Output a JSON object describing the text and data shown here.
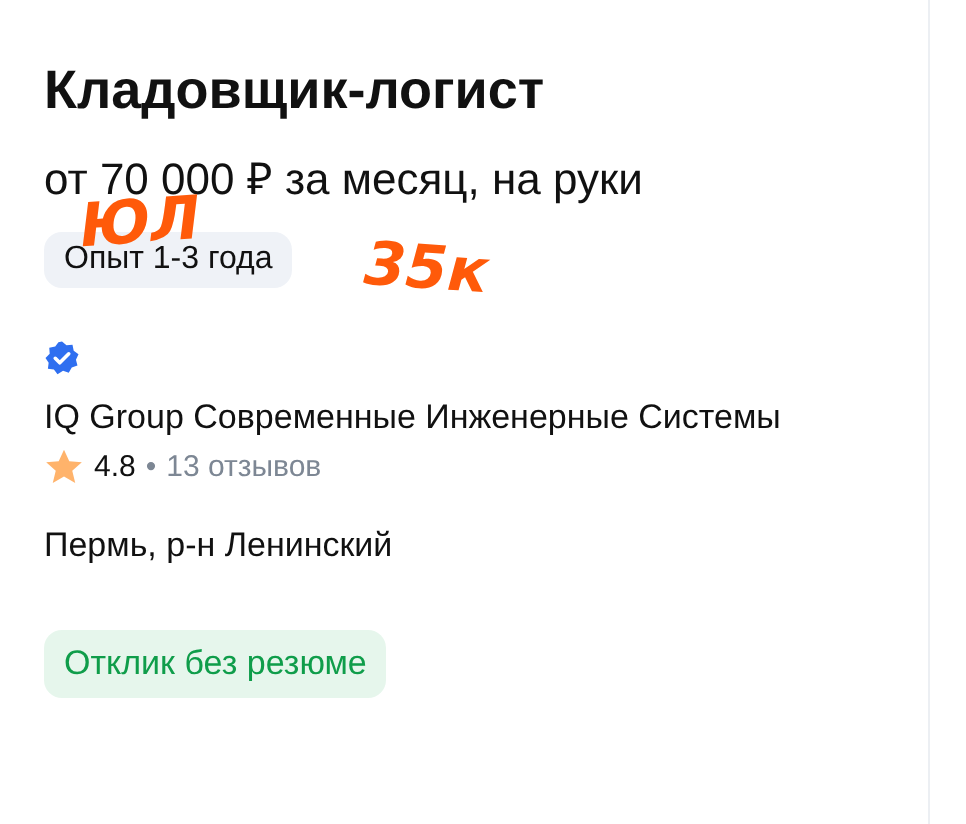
{
  "vacancy": {
    "title": "Кладовщик-логист",
    "salary": "от 70 000 ₽ за месяц, на руки",
    "experience": "Опыт 1-3 года"
  },
  "employer": {
    "verified": true,
    "name": "IQ Group Современные Инженерные Системы",
    "rating": "4.8",
    "separator": "•",
    "reviews": "13 отзывов"
  },
  "location": "Пермь, р-н Ленинский",
  "action": {
    "label": "Отклик без резюме"
  },
  "annotations": [
    {
      "text": "ЮЛ"
    },
    {
      "text": "35к"
    }
  ]
}
